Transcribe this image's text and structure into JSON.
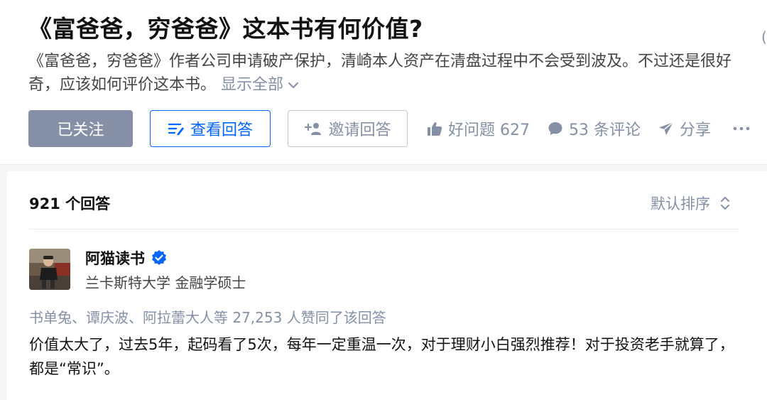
{
  "question": {
    "title": "《富爸爸，穷爸爸》这本书有何价值?",
    "detail": "《富爸爸，穷爸爸》作者公司申请破产保护，清崎本人资产在清盘过程中不会受到波及。不过还是很好奇，应该如何评价这本书。",
    "show_all": "显示全部"
  },
  "actions": {
    "followed": "已关注",
    "view_answers": "查看回答",
    "invite": "邀请回答",
    "good_question": "好问题 627",
    "comments": "53 条评论",
    "share": "分享"
  },
  "answers": {
    "count": "921 个回答",
    "sort": "默认排序"
  },
  "answer": {
    "author": "阿猫读书",
    "bio": "兰卡斯特大学 金融学硕士",
    "voters": "书单兔、谭庆波、阿拉蕾大人等 27,253 人赞同了该回答",
    "body": "价值太大了，过去5年，起码看了5次，每年一定重温一次，对于理财小白强烈推荐！对于投资老手就算了，都是“常识”。"
  },
  "icons": {
    "chevron": "chevron-down-icon",
    "list": "list-icon",
    "invite": "add-user-icon",
    "like": "thumbs-up-icon",
    "comment": "comment-icon",
    "share": "paper-plane-icon",
    "more": "more-icon",
    "sort": "sort-icon",
    "verified": "verified-badge-icon"
  },
  "colors": {
    "brand_blue": "#0066ff",
    "muted": "#8590a6",
    "text": "#121212"
  }
}
